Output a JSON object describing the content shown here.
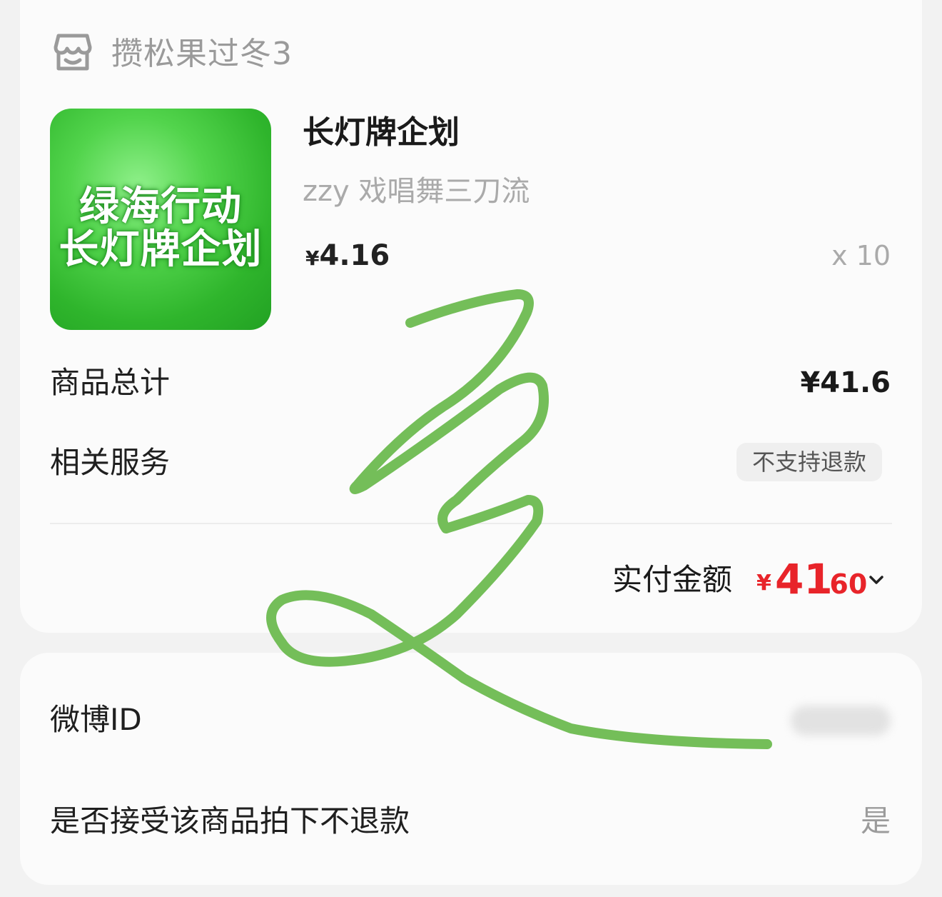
{
  "shop": {
    "name": "攒松果过冬3",
    "icon": "store-icon"
  },
  "product": {
    "image_text_line1": "绿海行动",
    "image_text_line2": "长灯牌企划",
    "title": "长灯牌企划",
    "spec": "zzy 戏唱舞三刀流",
    "price_currency": "¥",
    "price_value": "4.16",
    "quantity": "x 10"
  },
  "summary": {
    "subtotal_label": "商品总计",
    "subtotal_value": "¥41.6",
    "service_label": "相关服务",
    "service_tag": "不支持退款",
    "paid_label": "实付金额",
    "paid_currency": "¥",
    "paid_integer": "41",
    "paid_decimal": ".60"
  },
  "extra": {
    "weibo_label": "微博ID",
    "accept_label": "是否接受该商品拍下不退款",
    "accept_value": "是"
  },
  "colors": {
    "price_red": "#e8242a",
    "scribble_green": "#74be59",
    "thumb_green": "#3cc63a"
  }
}
